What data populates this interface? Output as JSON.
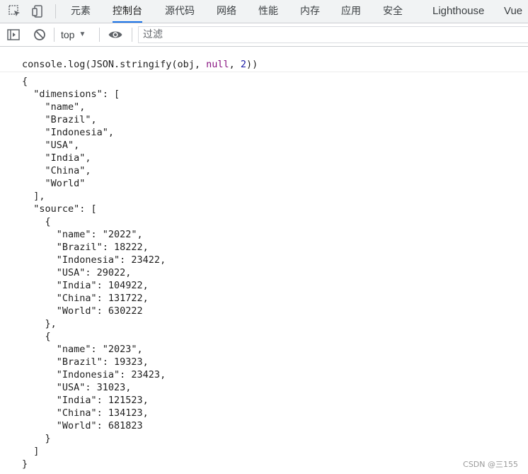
{
  "tabbar": {
    "tools": [
      {
        "icon": "inspect-element-icon"
      },
      {
        "icon": "device-toolbar-icon"
      }
    ],
    "tabs": [
      {
        "label": "元素",
        "active": false
      },
      {
        "label": "控制台",
        "active": true
      },
      {
        "label": "源代码",
        "active": false
      },
      {
        "label": "网络",
        "active": false
      },
      {
        "label": "性能",
        "active": false
      },
      {
        "label": "内存",
        "active": false
      },
      {
        "label": "应用",
        "active": false
      },
      {
        "label": "安全",
        "active": false
      },
      {
        "label": "Lighthouse",
        "active": false
      },
      {
        "label": "Vue",
        "active": false
      }
    ]
  },
  "toolbar": {
    "sidebar_icon": "show-sidebar-icon",
    "clear_icon": "clear-console-icon",
    "context": "top",
    "eye_icon": "live-expression-eye-icon",
    "filter_placeholder": "过滤",
    "filter_value": ""
  },
  "console": {
    "command": {
      "prefix": "console.log(JSON.stringify(obj, ",
      "null_kw": "null",
      "comma": ", ",
      "indent_num": "2",
      "suffix": "))"
    },
    "output_lines": [
      "{",
      "  \"dimensions\": [",
      "    \"name\",",
      "    \"Brazil\",",
      "    \"Indonesia\",",
      "    \"USA\",",
      "    \"India\",",
      "    \"China\",",
      "    \"World\"",
      "  ],",
      "  \"source\": [",
      "    {",
      "      \"name\": \"2022\",",
      "      \"Brazil\": 18222,",
      "      \"Indonesia\": 23422,",
      "      \"USA\": 29022,",
      "      \"India\": 104922,",
      "      \"China\": 131722,",
      "      \"World\": 630222",
      "    },",
      "    {",
      "      \"name\": \"2023\",",
      "      \"Brazil\": 19323,",
      "      \"Indonesia\": 23423,",
      "      \"USA\": 31023,",
      "      \"India\": 121523,",
      "      \"China\": 134123,",
      "      \"World\": 681823",
      "    }",
      "  ]",
      "}"
    ]
  },
  "watermark": "CSDN @三155",
  "colors": {
    "active_tab_underline": "#1a73e8",
    "null_keyword": "#881280",
    "number": "#1a1aa6"
  }
}
